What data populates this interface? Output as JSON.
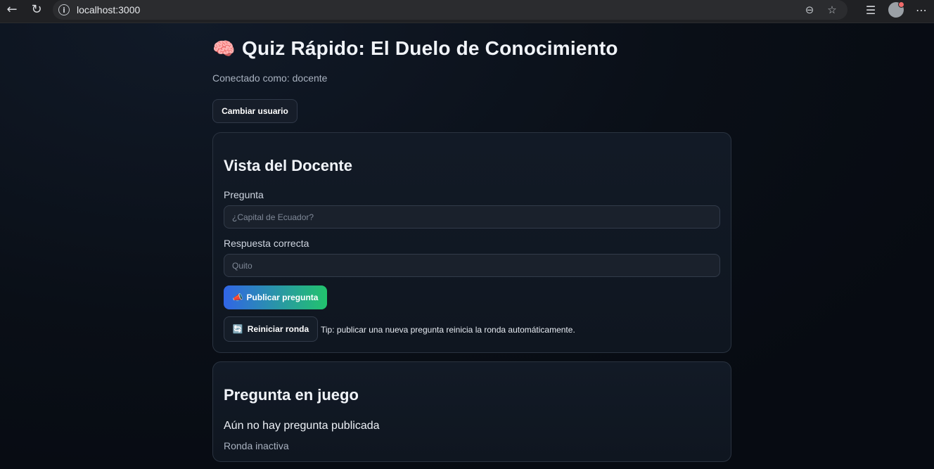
{
  "browser": {
    "url": "localhost:3000",
    "icons": {
      "back": "back-arrow-icon",
      "reload": "reload-icon",
      "info": "info-icon",
      "zoom": "zoom-out-icon",
      "favorite": "star-icon",
      "favorites_list": "favorites-icon",
      "profile": "avatar",
      "menu": "more-icon"
    }
  },
  "app": {
    "title": "Quiz Rápido: El Duelo de Conocimiento",
    "title_icon": "brain-icon",
    "connected_as": "Conectado como: docente",
    "change_user_label": "Cambiar usuario"
  },
  "teacher_view": {
    "heading": "Vista del Docente",
    "question_label": "Pregunta",
    "question_placeholder": "¿Capital de Ecuador?",
    "question_value": "",
    "answer_label": "Respuesta correcta",
    "answer_placeholder": "Quito",
    "answer_value": "",
    "publish_button": "Publicar pregunta",
    "publish_icon": "megaphone-icon",
    "reset_button": "Reiniciar ronda",
    "reset_icon": "repeat-icon",
    "tip": "Tip: publicar una nueva pregunta reinicia la ronda automáticamente."
  },
  "current_question": {
    "heading": "Pregunta en juego",
    "message": "Aún no hay pregunta publicada",
    "status": "Ronda inactiva"
  },
  "colors": {
    "publish_gradient_start": "#3165e6",
    "publish_gradient_end": "#22c36d"
  }
}
